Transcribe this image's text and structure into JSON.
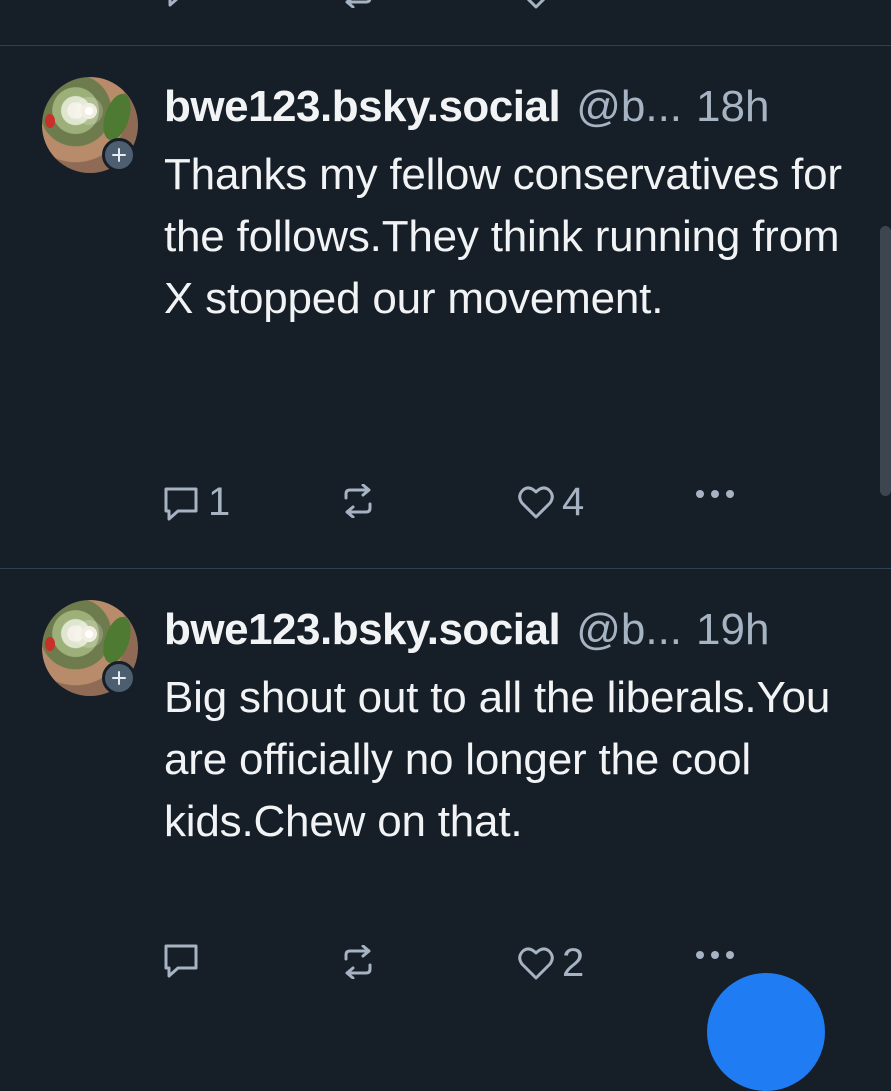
{
  "posts": [
    {
      "display_name": "bwe123.bsky.social",
      "handle": "@b...",
      "time": "18h",
      "text": "Thanks my fellow conservatives for the follows.They think running from X stopped our movement.",
      "reply_count": "1",
      "repost_count": "",
      "like_count": "4"
    },
    {
      "display_name": "bwe123.bsky.social",
      "handle": "@b...",
      "time": "19h",
      "text": "Big shout out to all the liberals.You are officially no longer the cool kids.Chew on that.",
      "reply_count": "",
      "repost_count": "",
      "like_count": "2"
    }
  ],
  "icons": {
    "reply": "speech-bubble",
    "repost": "repeat-arrows",
    "like": "heart",
    "more": "ellipsis",
    "follow": "plus"
  },
  "colors": {
    "background": "#161e27",
    "text": "#f1f3f5",
    "muted": "#a5b3c2",
    "accent": "#1f7cf2"
  }
}
